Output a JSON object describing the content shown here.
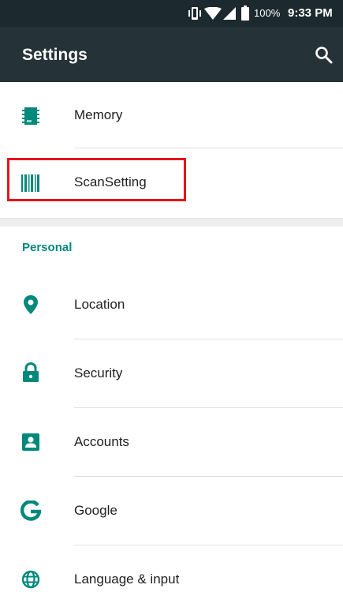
{
  "status_bar": {
    "battery_percent": "100%",
    "time": "9:33 PM",
    "icons": [
      "vibrate-icon",
      "wifi-icon",
      "signal-icon",
      "battery-icon"
    ]
  },
  "app_bar": {
    "title": "Settings",
    "search_icon": "search-icon"
  },
  "rows_top": [
    {
      "label": "Memory",
      "icon": "memory-chip-icon"
    },
    {
      "label": "ScanSetting",
      "icon": "barcode-icon"
    }
  ],
  "section": {
    "title": "Personal"
  },
  "rows_personal": [
    {
      "label": "Location",
      "icon": "location-pin-icon"
    },
    {
      "label": "Security",
      "icon": "lock-icon"
    },
    {
      "label": "Accounts",
      "icon": "account-box-icon"
    },
    {
      "label": "Google",
      "icon": "google-icon"
    },
    {
      "label": "Language & input",
      "icon": "globe-icon"
    }
  ],
  "colors": {
    "status_bar": "#1c2a2f",
    "app_bar": "#253338",
    "accent": "#00897b",
    "highlight": "#e8141c"
  }
}
